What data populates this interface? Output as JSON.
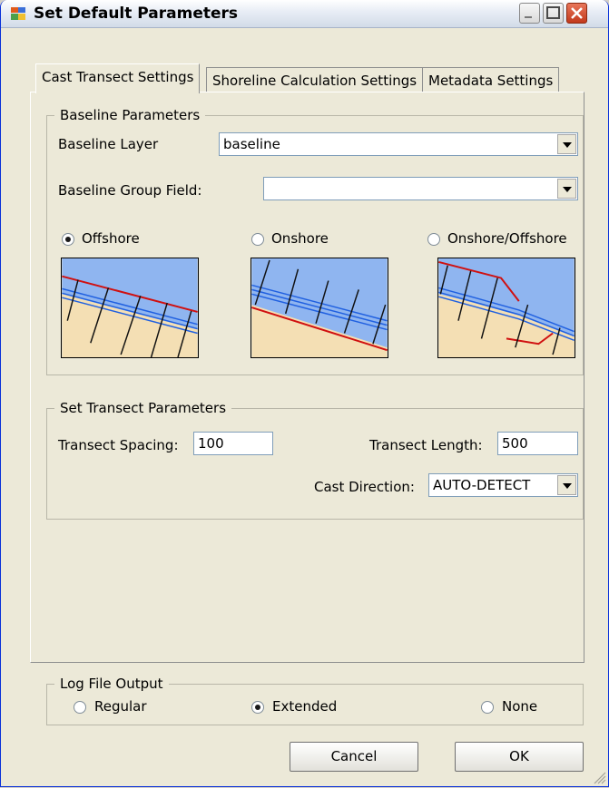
{
  "window": {
    "title": "Set Default Parameters"
  },
  "tabs": [
    {
      "label": "Cast Transect Settings"
    },
    {
      "label": "Shoreline Calculation Settings"
    },
    {
      "label": "Metadata Settings"
    }
  ],
  "baseline": {
    "legend": "Baseline Parameters",
    "layer_label": "Baseline Layer",
    "layer_value": "baseline",
    "group_field_label": "Baseline Group Field:",
    "group_field_value": "",
    "options": [
      {
        "label": "Offshore",
        "checked": true
      },
      {
        "label": "Onshore",
        "checked": false
      },
      {
        "label": "Onshore/Offshore",
        "checked": false
      }
    ]
  },
  "transect": {
    "legend": "Set Transect Parameters",
    "spacing_label": "Transect Spacing:",
    "spacing_value": "100",
    "length_label": "Transect Length:",
    "length_value": "500",
    "direction_label": "Cast Direction:",
    "direction_value": "AUTO-DETECT"
  },
  "log": {
    "legend": "Log File Output",
    "options": [
      {
        "label": "Regular",
        "checked": false
      },
      {
        "label": "Extended",
        "checked": true
      },
      {
        "label": "None",
        "checked": false
      }
    ]
  },
  "buttons": {
    "cancel": "Cancel",
    "ok": "OK"
  },
  "colors": {
    "sea": "#8fb5f0",
    "sand": "#f4dfb4",
    "baseline_red": "#d01010",
    "shoreline_blue": "#2060e0"
  }
}
